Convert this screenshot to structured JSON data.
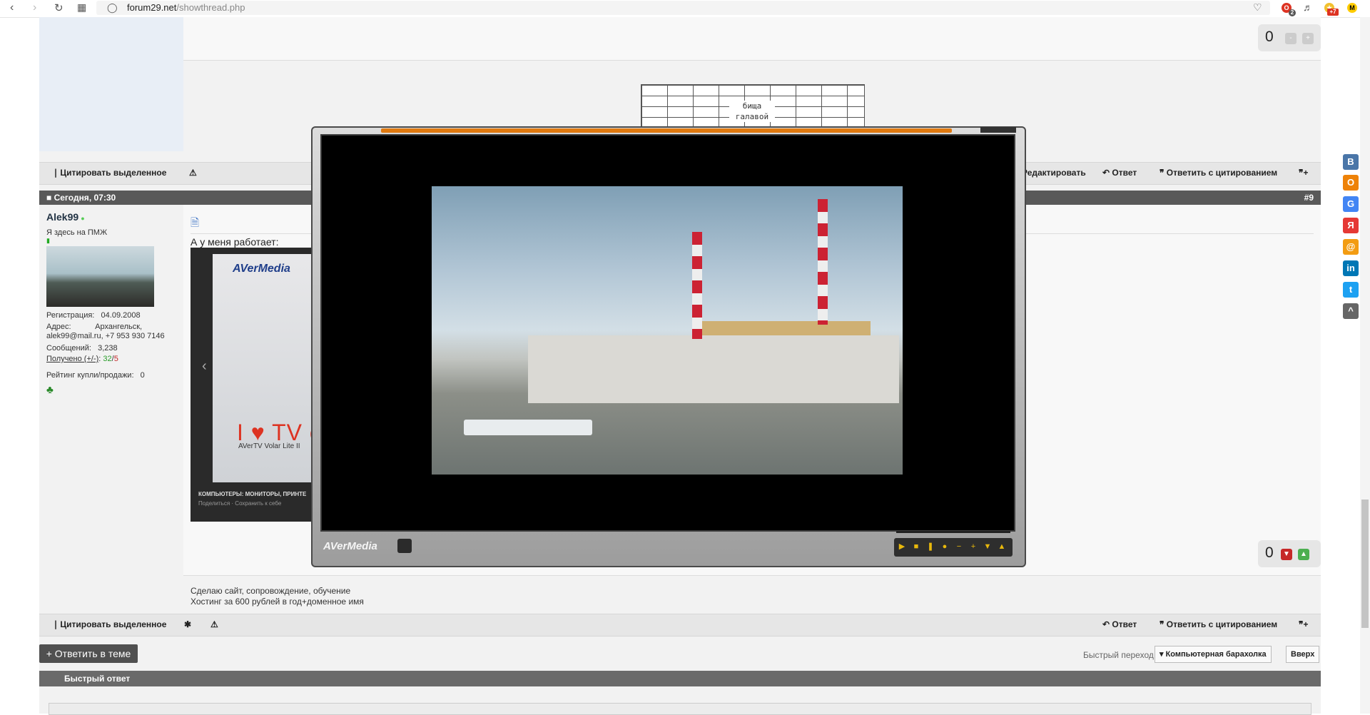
{
  "browser": {
    "url_host": "forum29.net",
    "url_path": "/showthread.php",
    "badge_count": "2",
    "badge_new": "+7",
    "profile_letter": "M"
  },
  "top_post": {
    "rating": "0",
    "image_text": "бища\nгалавой"
  },
  "actionbar1": {
    "quote_selected": "Цитировать выделенное",
    "edit": "Редактировать",
    "reply": "Ответ",
    "reply_quote": "Ответить с цитированием"
  },
  "post": {
    "date": "Сегодня, 07:30",
    "number": "#9",
    "username": "Alek99",
    "user_title": "Я здесь на ПМЖ",
    "reg_label": "Регистрация:",
    "reg_value": "04.09.2008",
    "addr_label": "Адрес:",
    "addr_value": "Архангельск,",
    "addr_line2": "alek99@mail.ru, +7 953 930 7146",
    "msgs_label": "Сообщений:",
    "msgs_value": "3,238",
    "received_label": "Получено (+/-)",
    "received_plus": "32",
    "received_sep": "/",
    "received_minus": "5",
    "trade_label": "Рейтинг купли/продажи:",
    "trade_value": "0",
    "text": "А у меня работает:",
    "rating": "0",
    "embed_brand": "AVerMedia",
    "embed_caption": "КОМПЬЮТЕРЫ: МОНИТОРЫ, ПРИНТЕ",
    "embed_share": "Поделиться",
    "embed_save": "Сохранить к себе",
    "box_big": "I ♥ TV o",
    "box_model": "AVerTV Volar Lite II",
    "signature_line1": "Сделаю сайт, сопровождение, обучение",
    "signature_line2": "Хостинг за 600 рублей в год+доменное имя"
  },
  "actionbar2": {
    "quote_selected": "Цитировать выделенное",
    "reply": "Ответ",
    "reply_quote": "Ответить с цитированием"
  },
  "footer": {
    "reply_thread": "+ Ответить в теме",
    "quick_nav_label": "Быстрый переход",
    "forum_select": "Компьютерная барахолка",
    "top": "Вверх",
    "quick_reply": "Быстрый ответ"
  },
  "player": {
    "brand": "AVerMedia"
  },
  "share_icons": [
    "В",
    "О",
    "G",
    "Я",
    "@",
    "in",
    "t",
    "^"
  ],
  "colors": {
    "accent_player": "#e07a10",
    "post_header": "#595959",
    "positive": "#2a9d2a",
    "negative": "#c62828"
  }
}
